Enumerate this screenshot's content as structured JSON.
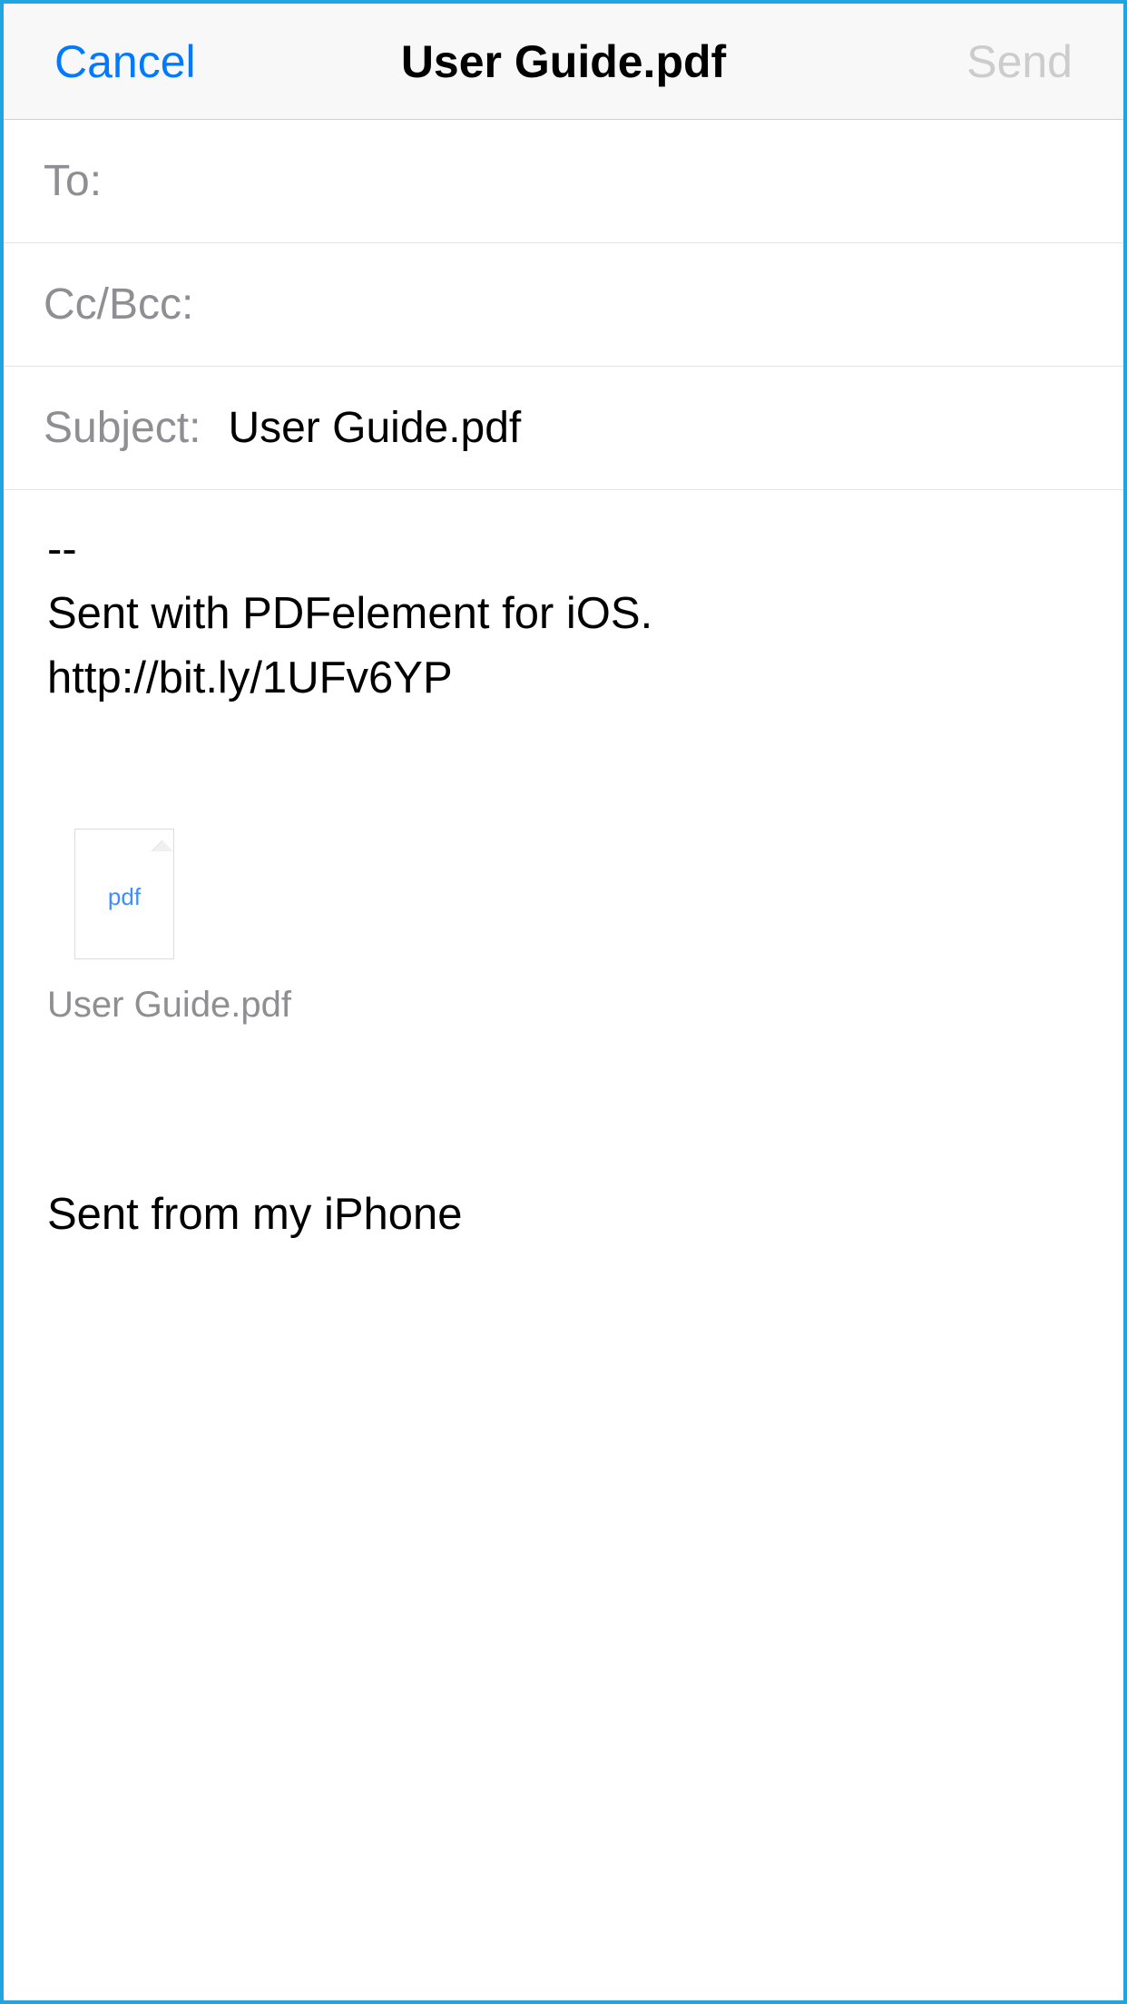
{
  "navbar": {
    "cancel": "Cancel",
    "title": "User Guide.pdf",
    "send": "Send"
  },
  "fields": {
    "to_label": "To:",
    "to_value": "",
    "ccbcc_label": "Cc/Bcc:",
    "ccbcc_value": "",
    "subject_label": "Subject:",
    "subject_value": "User Guide.pdf"
  },
  "body": {
    "text": "--\nSent with PDFelement for iOS.\nhttp://bit.ly/1UFv6YP"
  },
  "attachment": {
    "icon_label": "pdf",
    "filename": "User Guide.pdf"
  },
  "signature": "Sent from my iPhone"
}
